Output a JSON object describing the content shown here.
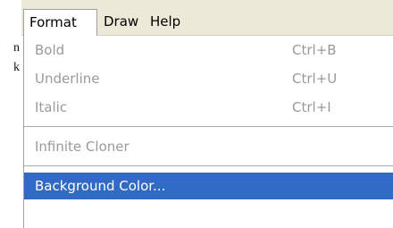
{
  "background": {
    "glyphs": [
      "n",
      "k"
    ]
  },
  "menubar": {
    "items": [
      {
        "label": "Format",
        "open": true
      },
      {
        "label": "Draw"
      },
      {
        "label": "Help"
      }
    ]
  },
  "format_menu": {
    "items": [
      {
        "label": "Bold",
        "shortcut": "Ctrl+B",
        "enabled": false
      },
      {
        "label": "Underline",
        "shortcut": "Ctrl+U",
        "enabled": false
      },
      {
        "label": "Italic",
        "shortcut": "Ctrl+I",
        "enabled": false
      },
      {
        "label": "Infinite Cloner",
        "enabled": false
      },
      {
        "label": "Background Color...",
        "enabled": true,
        "highlighted": true
      }
    ]
  },
  "colors": {
    "menubar": "#ece9d8",
    "highlight": "#316ac5",
    "disabled_text": "#9a9a9a"
  }
}
